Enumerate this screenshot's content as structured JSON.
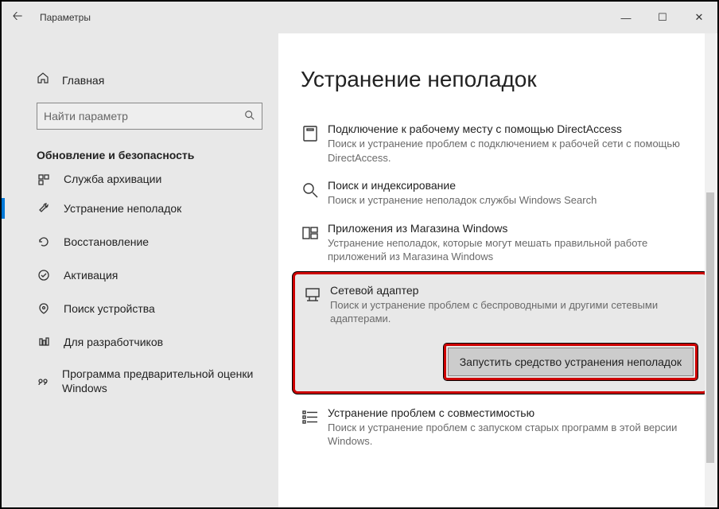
{
  "window": {
    "app_title": "Параметры"
  },
  "sidebar": {
    "home_label": "Главная",
    "search_placeholder": "Найти параметр",
    "section_title": "Обновление и безопасность",
    "items": [
      {
        "label": "Служба архивации"
      },
      {
        "label": "Устранение неполадок"
      },
      {
        "label": "Восстановление"
      },
      {
        "label": "Активация"
      },
      {
        "label": "Поиск устройства"
      },
      {
        "label": "Для разработчиков"
      },
      {
        "label": "Программа предварительной оценки Windows"
      }
    ]
  },
  "content": {
    "page_title": "Устранение неполадок",
    "items": [
      {
        "title": "Подключение к рабочему месту с помощью DirectAccess",
        "desc": "Поиск и устранение проблем с подключением к рабочей сети с помощью DirectAccess."
      },
      {
        "title": "Поиск и индексирование",
        "desc": "Поиск и устранение неполадок службы Windows Search"
      },
      {
        "title": "Приложения из Магазина Windows",
        "desc": "Устранение неполадок, которые могут мешать правильной работе приложений из Магазина Windows"
      },
      {
        "title": "Сетевой адаптер",
        "desc": "Поиск и устранение проблем с беспроводными и другими сетевыми адаптерами.",
        "run_label": "Запустить средство устранения неполадок"
      },
      {
        "title": "Устранение проблем с совместимостью",
        "desc": "Поиск и устранение проблем с запуском старых программ в этой версии Windows."
      }
    ]
  }
}
